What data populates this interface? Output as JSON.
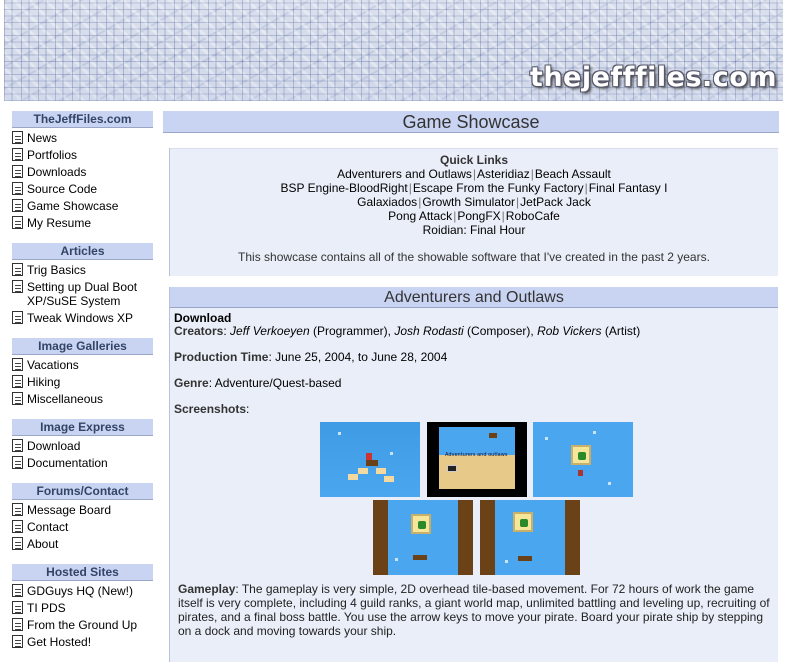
{
  "site": {
    "logo_text": "thejefffiles.com"
  },
  "sidebar": {
    "sections": [
      {
        "title": "TheJeffFiles.com",
        "items": [
          "News",
          "Portfolios",
          "Downloads",
          "Source Code",
          "Game Showcase",
          "My Resume"
        ]
      },
      {
        "title": "Articles",
        "items": [
          "Trig Basics",
          "Setting up Dual Boot XP/SuSE System",
          "Tweak Windows XP"
        ]
      },
      {
        "title": "Image Galleries",
        "items": [
          "Vacations",
          "Hiking",
          "Miscellaneous"
        ]
      },
      {
        "title": "Image Express",
        "items": [
          "Download",
          "Documentation"
        ]
      },
      {
        "title": "Forums/Contact",
        "items": [
          "Message Board",
          "Contact",
          "About"
        ]
      },
      {
        "title": "Hosted Sites",
        "items": [
          "GDGuys HQ (New!)",
          "TI PDS",
          "From the Ground Up",
          "Get Hosted!"
        ]
      }
    ]
  },
  "main": {
    "title": "Game Showcase",
    "quick_links": {
      "title": "Quick Links",
      "lines": [
        [
          "Adventurers and Outlaws",
          "Asteridiaz",
          "Beach Assault"
        ],
        [
          "BSP Engine-BloodRight",
          "Escape From the Funky Factory",
          "Final Fantasy I"
        ],
        [
          "Galaxiados",
          "Growth Simulator",
          "JetPack Jack"
        ],
        [
          "Pong Attack",
          "PongFX",
          "RoboCafe"
        ],
        [
          "Roidian: Final Hour"
        ]
      ]
    },
    "description": "This showcase contains all of the showable software that I've created in the past 2 years."
  },
  "game": {
    "title": "Adventurers and Outlaws",
    "download_label": "Download",
    "creators_label": "Creators",
    "creators": [
      {
        "name": "Jeff Verkoeyen",
        "role": "(Programmer)"
      },
      {
        "name": "Josh Rodasti",
        "role": "(Composer)"
      },
      {
        "name": "Rob Vickers",
        "role": "(Artist)"
      }
    ],
    "production_label": "Production Time",
    "production_time": "June 25, 2004, to June 28, 2004",
    "genre_label": "Genre",
    "genre": "Adventure/Quest-based",
    "screenshots_label": "Screenshots",
    "screenshot_tiny_text": "Adventurers and outlaws",
    "gameplay_label": "Gameplay",
    "gameplay_text": "The gameplay is very simple, 2D overhead tile-based movement. For 72 hours of work the game itself is very complete, including 4 guild ranks, a giant world map, unlimited battling and leveling up, recruiting of pirates, and a final boss battle. You use the arrow keys to move your pirate. Board your pirate ship by stepping on a dock and moving towards your ship."
  },
  "colors": {
    "header_bg": "#c9d4f2",
    "panel_bg": "#e9eef8",
    "game_sky": "#4aa6ee",
    "wall_brown": "#6b4218"
  }
}
